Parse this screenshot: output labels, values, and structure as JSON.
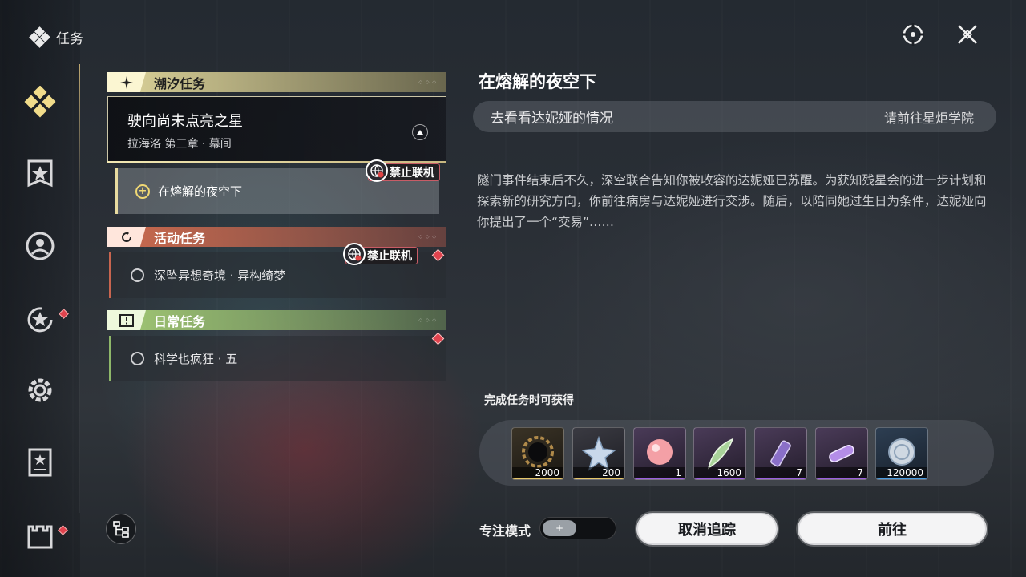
{
  "header": {
    "title": "任务",
    "icon": "diamond-cluster-icon"
  },
  "top_right": {
    "icons": [
      "target-scope-icon",
      "close-x-icon"
    ]
  },
  "sidebar": {
    "items": [
      {
        "icon": "diamond-cluster-icon",
        "active": true,
        "dot": false
      },
      {
        "icon": "shield-banner-icon",
        "active": false,
        "dot": false
      },
      {
        "icon": "profile-circle-icon",
        "active": false,
        "dot": false
      },
      {
        "icon": "star-refresh-icon",
        "active": false,
        "dot": true
      },
      {
        "icon": "gear-icon",
        "active": false,
        "dot": false
      },
      {
        "icon": "book-star-icon",
        "active": false,
        "dot": false
      },
      {
        "icon": "castle-icon",
        "active": false,
        "dot": true
      }
    ],
    "tree_icon": "quest-tree-icon"
  },
  "quest_list": {
    "tide": {
      "label": "潮汐任务",
      "main": {
        "title": "驶向尚未点亮之星",
        "subtitle": "拉海洛 第三章 · 幕间"
      },
      "sub": {
        "label": "在熔解的夜空下",
        "tag": "禁止联机"
      }
    },
    "activity": {
      "label": "活动任务",
      "tag": "禁止联机",
      "item": "深坠异想奇境 · 异构绮梦"
    },
    "daily": {
      "label": "日常任务",
      "item": "科学也疯狂 · 五"
    }
  },
  "detail": {
    "title": "在熔解的夜空下",
    "objective": "去看看达妮娅的情况",
    "location": "请前往星炬学院",
    "description": "隧门事件结束后不久，深空联合告知你被收容的达妮娅已苏醒。为获知残星会的进一步计划和探索新的研究方向，你前往病房与达妮娅进行交涉。随后，以陪同她过生日为条件，达妮娅向你提出了一个“交易”……",
    "rewards_title": "完成任务时可获得",
    "rewards": [
      {
        "icon": "dark-gear-orb-icon",
        "qty": "2000",
        "rarity_color": "#e6c66a"
      },
      {
        "icon": "crystal-star-icon",
        "qty": "200",
        "rarity_color": "#e6c66a"
      },
      {
        "icon": "pink-orb-icon",
        "qty": "1",
        "rarity_color": "#9b5fe0"
      },
      {
        "icon": "green-feather-icon",
        "qty": "1600",
        "rarity_color": "#9b5fe0"
      },
      {
        "icon": "purple-vial-icon",
        "qty": "7",
        "rarity_color": "#9b5fe0"
      },
      {
        "icon": "purple-capsule-icon",
        "qty": "7",
        "rarity_color": "#9b5fe0"
      },
      {
        "icon": "shell-coin-icon",
        "qty": "120000",
        "rarity_color": "#4a9be0"
      }
    ]
  },
  "footer": {
    "focus_label": "专注模式",
    "cancel_label": "取消追踪",
    "go_label": "前往"
  }
}
